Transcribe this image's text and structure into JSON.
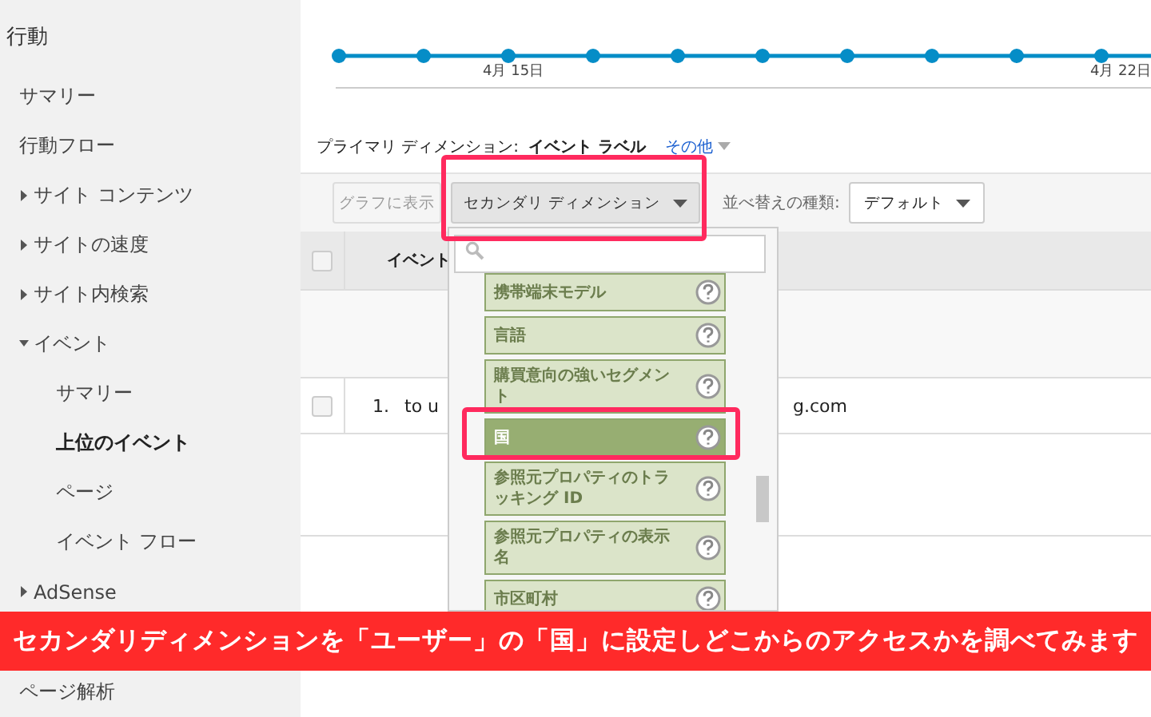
{
  "sidebar": {
    "heading": "行動",
    "items": [
      {
        "label": "サマリー",
        "kind": "leaf",
        "selected": false
      },
      {
        "label": "行動フロー",
        "kind": "leaf",
        "selected": false
      },
      {
        "label": "サイト コンテンツ",
        "kind": "folder",
        "expanded": false,
        "selected": false
      },
      {
        "label": "サイトの速度",
        "kind": "folder",
        "expanded": false,
        "selected": false
      },
      {
        "label": "サイト内検索",
        "kind": "folder",
        "expanded": false,
        "selected": false
      },
      {
        "label": "イベント",
        "kind": "folder",
        "expanded": true,
        "selected": false,
        "children": [
          {
            "label": "サマリー",
            "kind": "leaf",
            "selected": false
          },
          {
            "label": "上位のイベント",
            "kind": "leaf",
            "selected": true
          },
          {
            "label": "ページ",
            "kind": "leaf",
            "selected": false
          },
          {
            "label": "イベント フロー",
            "kind": "leaf",
            "selected": false
          }
        ]
      },
      {
        "label": "AdSense",
        "kind": "folder",
        "expanded": false,
        "selected": false
      }
    ],
    "footer_items": [
      {
        "label": "ページ解析",
        "kind": "leaf",
        "selected": false
      }
    ]
  },
  "chart": {
    "x_labels": [
      "4月 15日",
      "4月 22日"
    ]
  },
  "primary_dimension": {
    "label": "プライマリ ディメンション:",
    "value": "イベント ラベル",
    "other": "その他"
  },
  "toolbar": {
    "graph_button": {
      "label": "グラフに表示",
      "disabled": true
    },
    "secondary_dimension": {
      "label": "セカンダリ ディメンション"
    },
    "sort_label": "並べ替えの種類:",
    "sort_select": {
      "value": "デフォルト"
    }
  },
  "table": {
    "header": "イベント",
    "header_checked": false,
    "rows": [
      {
        "index": "1.",
        "label_start": "to u",
        "label_end": "g.com",
        "checked": false
      }
    ]
  },
  "dropdown": {
    "items": [
      {
        "label": "携帯端末モデル",
        "selected": false
      },
      {
        "label": "言語",
        "selected": false
      },
      {
        "label": "購買意向の強いセグメント",
        "selected": false
      },
      {
        "label": "国",
        "selected": true
      },
      {
        "label": "参照元プロパティのトラッキング ID",
        "selected": false
      },
      {
        "label": "参照元プロパティの表示名",
        "selected": false
      },
      {
        "label": "市区町村",
        "selected": false
      }
    ]
  },
  "banner": {
    "text": "セカンダリディメンションを「ユーザー」の「国」に設定しどこからのアクセスかを調べてみます"
  }
}
